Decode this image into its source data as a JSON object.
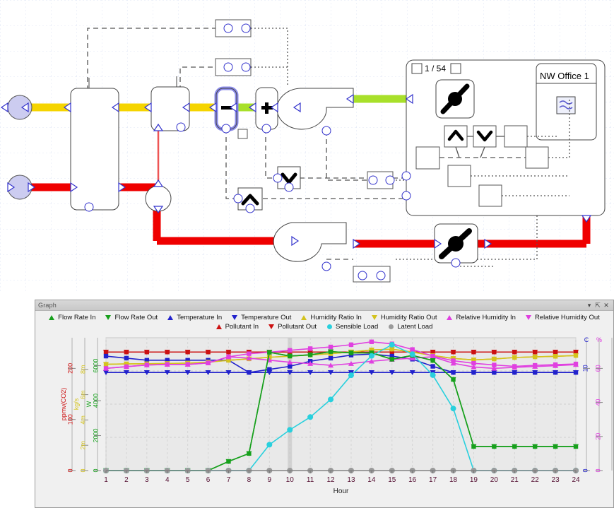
{
  "schematic": {
    "loop_counter": "1 / 54",
    "room_label": "NW Office 1",
    "op_minus": "–",
    "op_plus": "+",
    "colors": {
      "supply_air_yellow": "#f5d400",
      "mixed_air_green": "#a8e02a",
      "return_water_red": "#ef0000",
      "hot_red_thin": "#ee5555",
      "port_blue": "#3333cc",
      "selected_highlight": "#8a8ae8"
    }
  },
  "graph": {
    "title": "Graph",
    "window_buttons": [
      {
        "name": "dropdown",
        "glyph": "▾"
      },
      {
        "name": "pin",
        "glyph": "⇱"
      },
      {
        "name": "close",
        "glyph": "✕"
      }
    ],
    "legend": [
      {
        "label": "Flow Rate In",
        "color": "#17a01c",
        "marker": "tri-up"
      },
      {
        "label": "Flow Rate Out",
        "color": "#17a01c",
        "marker": "tri-down"
      },
      {
        "label": "Temperature In",
        "color": "#2222cc",
        "marker": "tri-up"
      },
      {
        "label": "Temperature Out",
        "color": "#2222cc",
        "marker": "tri-down"
      },
      {
        "label": "Humidity Ratio In",
        "color": "#d4c31e",
        "marker": "tri-up"
      },
      {
        "label": "Humidity Ratio Out",
        "color": "#d4c31e",
        "marker": "tri-down"
      },
      {
        "label": "Relative Humidity In",
        "color": "#e040e0",
        "marker": "tri-up"
      },
      {
        "label": "Relative Humidity Out",
        "color": "#e040e0",
        "marker": "tri-down"
      },
      {
        "label": "Pollutant In",
        "color": "#cc1111",
        "marker": "tri-up"
      },
      {
        "label": "Pollutant Out",
        "color": "#cc1111",
        "marker": "tri-down"
      },
      {
        "label": "Sensible Load",
        "color": "#29d0dd",
        "marker": "circle"
      },
      {
        "label": "Latent Load",
        "color": "#9a9a9a",
        "marker": "circle"
      }
    ]
  },
  "chart_data": {
    "type": "line",
    "title": "",
    "xlabel": "Hour",
    "x": [
      1,
      2,
      3,
      4,
      5,
      6,
      7,
      8,
      9,
      10,
      11,
      12,
      13,
      14,
      15,
      16,
      17,
      18,
      19,
      20,
      21,
      22,
      23,
      24
    ],
    "grid": true,
    "legend_position": "top",
    "axes": [
      {
        "id": "co2",
        "label": "ppmv(CO2)",
        "color": "#cc1111",
        "side": "left",
        "ticks": [
          "0",
          "100",
          "200"
        ],
        "min": 0,
        "max": 260
      },
      {
        "id": "flow",
        "label": "kg/s",
        "color": "#d4c31e",
        "side": "left",
        "ticks": [
          "0",
          "2m",
          "4m",
          "6m",
          "8m",
          "kg/s"
        ],
        "min": 0,
        "max": 0.0105
      },
      {
        "id": "load",
        "label": "W",
        "color": "#17a01c",
        "side": "left",
        "ticks": [
          "0",
          "2000",
          "4000",
          "6000",
          "W"
        ],
        "min": 0,
        "max": 7600
      },
      {
        "id": "temp",
        "label": "C",
        "color": "#2222cc",
        "side": "right",
        "ticks": [
          "0",
          "10",
          "C"
        ],
        "min": 0,
        "max": 13
      },
      {
        "id": "rh",
        "label": "%",
        "color": "#e040e0",
        "side": "right",
        "ticks": [
          "0",
          "20",
          "40",
          "60",
          "%"
        ],
        "min": 0,
        "max": 78
      },
      {
        "id": "hum",
        "label": "",
        "color": "#29d0dd",
        "side": "right",
        "ticks": [],
        "min": 0,
        "max": 100
      }
    ],
    "highlight_hour": 10,
    "series": [
      {
        "name": "Pollutant In",
        "color": "#cc1111",
        "marker": "square",
        "axis": "co2",
        "values": [
          232,
          232,
          232,
          232,
          232,
          232,
          232,
          232,
          232,
          232,
          232,
          232,
          232,
          232,
          232,
          232,
          232,
          232,
          232,
          232,
          232,
          232,
          232,
          232
        ]
      },
      {
        "name": "Pollutant Out",
        "color": "#cc1111",
        "marker": "tri-down",
        "axis": "co2",
        "values": [
          232,
          232,
          232,
          232,
          232,
          232,
          232,
          232,
          232,
          232,
          232,
          232,
          232,
          232,
          232,
          232,
          232,
          232,
          232,
          232,
          232,
          232,
          232,
          232
        ]
      },
      {
        "name": "Temperature In",
        "color": "#2222cc",
        "marker": "square",
        "axis": "temp",
        "values": [
          11.2,
          11.0,
          10.8,
          10.8,
          10.8,
          10.8,
          10.8,
          9.6,
          9.9,
          10.2,
          10.7,
          11.0,
          11.3,
          11.4,
          11.2,
          10.9,
          10.2,
          9.6,
          9.6,
          9.6,
          9.6,
          9.6,
          9.6,
          9.6
        ]
      },
      {
        "name": "Temperature Out",
        "color": "#2222cc",
        "marker": "tri-down",
        "axis": "temp",
        "values": [
          9.6,
          9.6,
          9.6,
          9.6,
          9.6,
          9.6,
          9.6,
          9.6,
          9.6,
          9.6,
          9.6,
          9.6,
          9.6,
          9.6,
          9.6,
          9.6,
          9.6,
          9.6,
          9.6,
          9.6,
          9.6,
          9.6,
          9.6,
          9.6
        ]
      },
      {
        "name": "Humidity Ratio In",
        "color": "#d4c31e",
        "marker": "square",
        "axis": "hum",
        "values": [
          80,
          80.3,
          80.4,
          80.6,
          80.9,
          81.6,
          83.0,
          84.1,
          85.3,
          86.1,
          87.0,
          88.0,
          89.3,
          90.8,
          91.4,
          89.2,
          86.6,
          84.4,
          83.3,
          84.0,
          85.1,
          85.6,
          86.0,
          86.6
        ]
      },
      {
        "name": "Humidity Ratio Out",
        "color": "#d4c31e",
        "marker": "tri-down",
        "axis": "hum",
        "values": [
          80,
          80.3,
          80.4,
          80.6,
          80.9,
          81.6,
          83.0,
          84.1,
          85.3,
          86.1,
          87.0,
          88.0,
          89.3,
          90.8,
          91.4,
          89.2,
          86.6,
          84.4,
          83.3,
          84.0,
          85.1,
          85.6,
          86.0,
          86.6
        ]
      },
      {
        "name": "Relative Humidity In",
        "color": "#e040e0",
        "marker": "square",
        "axis": "rh",
        "values": [
          60,
          61,
          62,
          62.3,
          62.3,
          63.2,
          66.8,
          68.6,
          69.5,
          70.6,
          71.6,
          72.6,
          73.9,
          75.6,
          74.4,
          71.1,
          67.2,
          64.5,
          63.0,
          62.0,
          61.2,
          61.8,
          62.2,
          62.6
        ]
      },
      {
        "name": "Relative Humidity Out",
        "color": "#e040e0",
        "marker": "tri-up",
        "axis": "rh",
        "values": [
          60,
          61,
          62,
          62.3,
          62.3,
          63.2,
          66.8,
          66.0,
          64.8,
          63.6,
          62.8,
          61.8,
          62.8,
          64.2,
          65.2,
          66.0,
          66.8,
          63.0,
          60.8,
          60.0,
          60.6,
          61.1,
          61.6,
          62.2
        ]
      },
      {
        "name": "Flow Rate In",
        "color": "#17a01c",
        "marker": "square",
        "axis": "flow",
        "values": [
          0,
          0,
          0,
          0,
          0,
          0,
          0.00072,
          0.00135,
          0.00935,
          0.00905,
          0.00915,
          0.0094,
          0.0093,
          0.0093,
          0.0088,
          0.0091,
          0.0087,
          0.0072,
          0.0019,
          0.0019,
          0.0019,
          0.0019,
          0.0019,
          0.0019
        ]
      },
      {
        "name": "Flow Rate Out",
        "color": "#17a01c",
        "marker": "tri-down",
        "axis": "flow",
        "values": [
          0,
          0,
          0,
          0,
          0,
          0,
          0.00072,
          0.00135,
          0.00935,
          0.00905,
          0.00915,
          0.0094,
          0.0093,
          0.0093,
          0.0088,
          0.0091,
          0.0087,
          0.0072,
          0.0019,
          0.0019,
          0.0019,
          0.0019,
          0.0019,
          0.0019
        ]
      },
      {
        "name": "Sensible Load",
        "color": "#29d0dd",
        "marker": "circle",
        "axis": "load",
        "values": [
          0,
          0,
          0,
          0,
          0,
          0,
          0,
          0,
          1480,
          2330,
          3060,
          4070,
          5450,
          6560,
          7200,
          6660,
          5460,
          3550,
          0,
          0,
          0,
          0,
          0,
          0
        ]
      },
      {
        "name": "Latent Load",
        "color": "#9a9a9a",
        "marker": "circle",
        "axis": "load",
        "values": [
          0,
          0,
          0,
          0,
          0,
          0,
          0,
          0,
          0,
          0,
          0,
          0,
          0,
          0,
          0,
          0,
          0,
          0,
          0,
          0,
          0,
          0,
          0,
          0
        ]
      }
    ]
  }
}
